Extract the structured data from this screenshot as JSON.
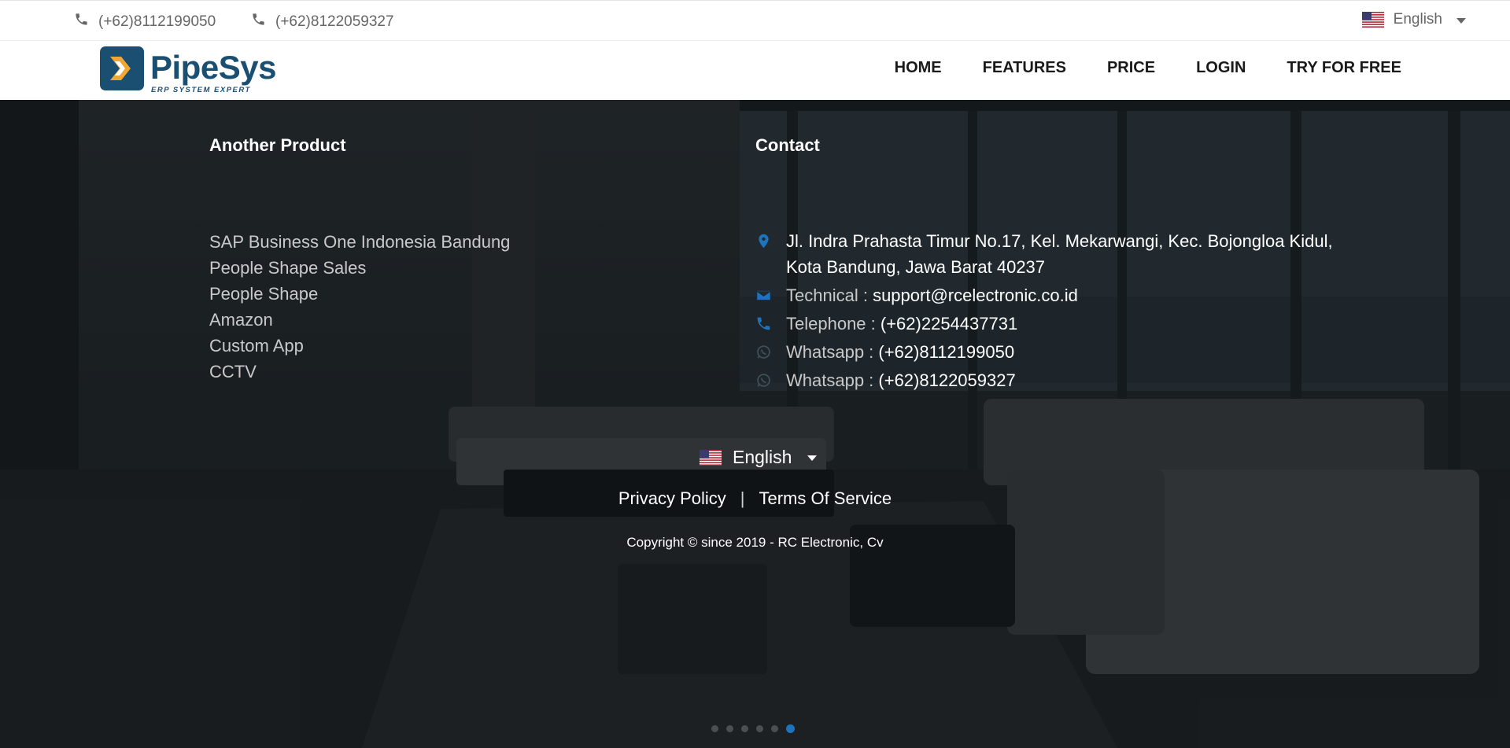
{
  "topbar": {
    "phone1": "(+62)8112199050",
    "phone2": "(+62)8122059327",
    "language": "English"
  },
  "brand": {
    "name": "PipeSys",
    "tagline": "ERP SYSTEM EXPERT",
    "primary_color": "#1b4f72",
    "accent_color": "#f0a830"
  },
  "nav": {
    "items": [
      "HOME",
      "FEATURES",
      "PRICE",
      "LOGIN",
      "TRY FOR FREE"
    ]
  },
  "products": {
    "title": "Another Product",
    "items": [
      "SAP Business One Indonesia Bandung",
      "People Shape Sales",
      "People Shape",
      "Amazon",
      "Custom App",
      "CCTV"
    ]
  },
  "contact": {
    "title": "Contact",
    "address": "Jl. Indra Prahasta Timur No.17, Kel. Mekarwangi, Kec. Bojongloa Kidul, Kota Bandung, Jawa Barat 40237",
    "technical_label": "Technical : ",
    "technical_value": "support@rcelectronic.co.id",
    "telephone_label": "Telephone : ",
    "telephone_value": "(+62)2254437731",
    "whatsapp1_label": "Whatsapp : ",
    "whatsapp1_value": "(+62)8112199050",
    "whatsapp2_label": "Whatsapp : ",
    "whatsapp2_value": "(+62)8122059327",
    "icon_color": "#1e73be"
  },
  "footer": {
    "language": "English",
    "privacy": "Privacy Policy",
    "separator": "|",
    "terms": "Terms Of Service",
    "copyright": "Copyright © since 2019 - RC Electronic, Cv"
  },
  "carousel": {
    "total": 6,
    "active_index": 5
  }
}
